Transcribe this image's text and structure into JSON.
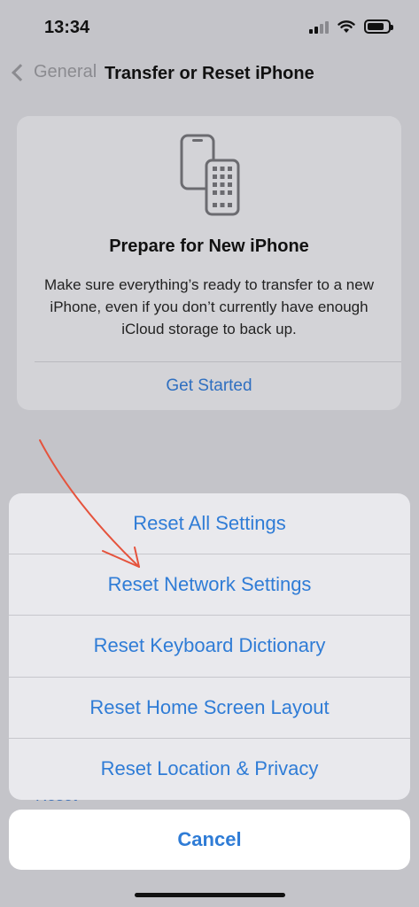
{
  "status_bar": {
    "time": "13:34"
  },
  "nav": {
    "back_label": "General",
    "title": "Transfer or Reset iPhone"
  },
  "prepare_card": {
    "title": "Prepare for New iPhone",
    "description": "Make sure everything’s ready to transfer to a new iPhone, even if you don’t currently have enough iCloud storage to back up.",
    "link": "Get Started"
  },
  "behind_text": "Reset",
  "action_sheet": {
    "items": [
      {
        "label": "Reset All Settings"
      },
      {
        "label": "Reset Network Settings"
      },
      {
        "label": "Reset Keyboard Dictionary"
      },
      {
        "label": "Reset Home Screen Layout"
      },
      {
        "label": "Reset Location & Privacy"
      }
    ],
    "cancel_label": "Cancel"
  },
  "colors": {
    "accent": "#2f7cd6",
    "annotation_arrow": "#e5533d"
  }
}
